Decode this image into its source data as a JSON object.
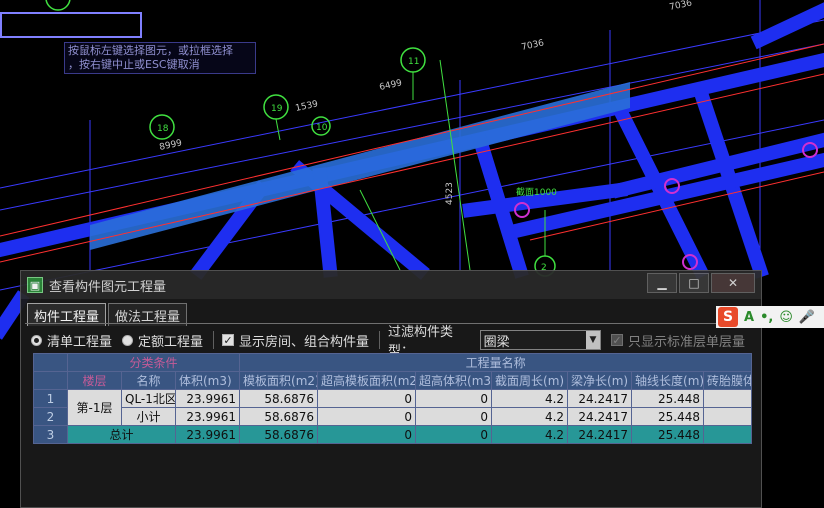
{
  "cad": {
    "hint_lines": [
      "按鼠标左键选择图元，或拉框选择",
      "，按右键中止或ESC键取消"
    ],
    "dimensions": [
      "7036",
      "7036",
      "6499",
      "1539",
      "8999",
      "4523",
      "1000"
    ],
    "axis_labels": [
      "11",
      "19",
      "18",
      "10",
      "2"
    ],
    "callout_text": "截面1000"
  },
  "dialog": {
    "title": "查看构件图元工程量",
    "buttons": {
      "minimize": "▁",
      "maximize": "□",
      "close": "✕"
    },
    "tabs": [
      "构件工程量",
      "做法工程量"
    ],
    "toolbar": {
      "radio_qd": "清单工程量",
      "radio_de": "定额工程量",
      "show_rooms": "显示房间、组合构件量",
      "filter_label": "过滤构件类型：",
      "filter_value": "圈梁",
      "std_floor_only": "只显示标准层单层量"
    },
    "table": {
      "group_headers": {
        "classify": "分类条件",
        "quantity": "工程量名称"
      },
      "sub_headers": [
        "楼层",
        "名称",
        "体积(m3)",
        "模板面积(m2)",
        "超高模板面积(m2)",
        "超高体积(m3)",
        "截面周长(m)",
        "梁净长(m)",
        "轴线长度(m)",
        "砖胎膜体"
      ],
      "rows": [
        {
          "no": "1",
          "floor": "第-1层",
          "name": "QL-1北区",
          "values": [
            "23.9961",
            "58.6876",
            "0",
            "0",
            "4.2",
            "24.2417",
            "25.448",
            ""
          ]
        },
        {
          "no": "2",
          "floor": "",
          "name": "小计",
          "values": [
            "23.9961",
            "58.6876",
            "0",
            "0",
            "4.2",
            "24.2417",
            "25.448",
            ""
          ]
        },
        {
          "no": "3",
          "total_label": "总计",
          "values": [
            "23.9961",
            "58.6876",
            "0",
            "0",
            "4.2",
            "24.2417",
            "25.448",
            ""
          ]
        }
      ]
    }
  },
  "ime": {
    "logo": "S",
    "items": [
      "A",
      "•,",
      "☺",
      "🎤"
    ]
  }
}
